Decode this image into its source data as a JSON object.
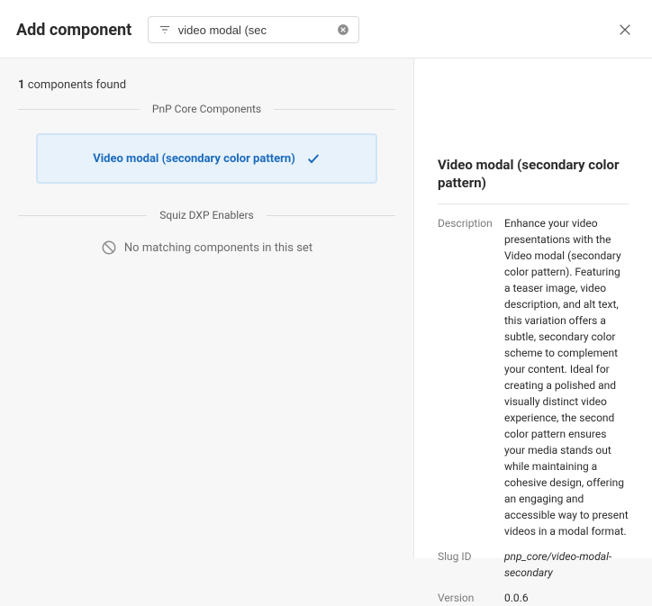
{
  "header": {
    "title": "Add component",
    "search_value": "video modal (sec"
  },
  "left": {
    "found_count": "1",
    "found_suffix": " components found",
    "section1": "PnP Core Components",
    "card_title": "Video modal (secondary color pattern)",
    "section2": "Squiz DXP Enablers",
    "empty": "No matching components in this set"
  },
  "detail": {
    "title": "Video modal (secondary color pattern)",
    "desc_label": "Description",
    "desc_value": "Enhance your video presentations with the Video modal (secondary color pattern). Featuring a teaser image, video description, and alt text, this variation offers a subtle, secondary color scheme to complement your content. Ideal for creating a polished and visually distinct video experience, the second color pattern ensures your media stands out while maintaining a cohesive design, offering an engaging and accessible way to present videos in a modal format.",
    "slug_label": "Slug ID",
    "slug_value": "pnp_core/video-modal-secondary",
    "version_label": "Version",
    "version_value": "0.0.6"
  }
}
